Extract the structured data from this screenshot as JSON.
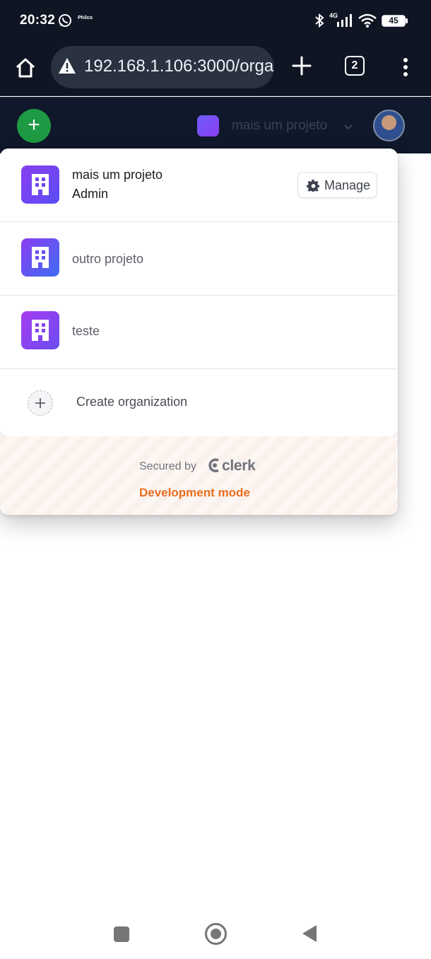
{
  "status_bar": {
    "time": "20:32",
    "carrier_badge": "Philco",
    "network_type": "4G",
    "battery_level": "45",
    "icons": [
      "whatsapp-icon",
      "bluetooth-icon",
      "signal-icon",
      "wifi-icon",
      "battery-icon"
    ]
  },
  "browser": {
    "url": "192.168.1.106:3000/orga",
    "tab_count": "2",
    "icons": [
      "home-icon",
      "warning-icon",
      "plus-icon",
      "tabs-icon",
      "more-vert-icon"
    ]
  },
  "header": {
    "add_label": "+",
    "current_org": "mais um projeto"
  },
  "org_switcher": {
    "active_org": {
      "name": "mais um projeto",
      "role": "Admin",
      "manage_label": "Manage"
    },
    "other_orgs": [
      {
        "name": "outro projeto"
      },
      {
        "name": "teste"
      }
    ],
    "create_label": "Create organization",
    "footer": {
      "secured_by": "Secured by",
      "brand": "clerk",
      "dev_mode": "Development mode"
    }
  },
  "colors": {
    "top_bar": "#0f1522",
    "header": "#10182b",
    "add_button": "#1f9a44",
    "org_icon": "#6b4cf3",
    "dev_mode": "#e86d1e"
  }
}
